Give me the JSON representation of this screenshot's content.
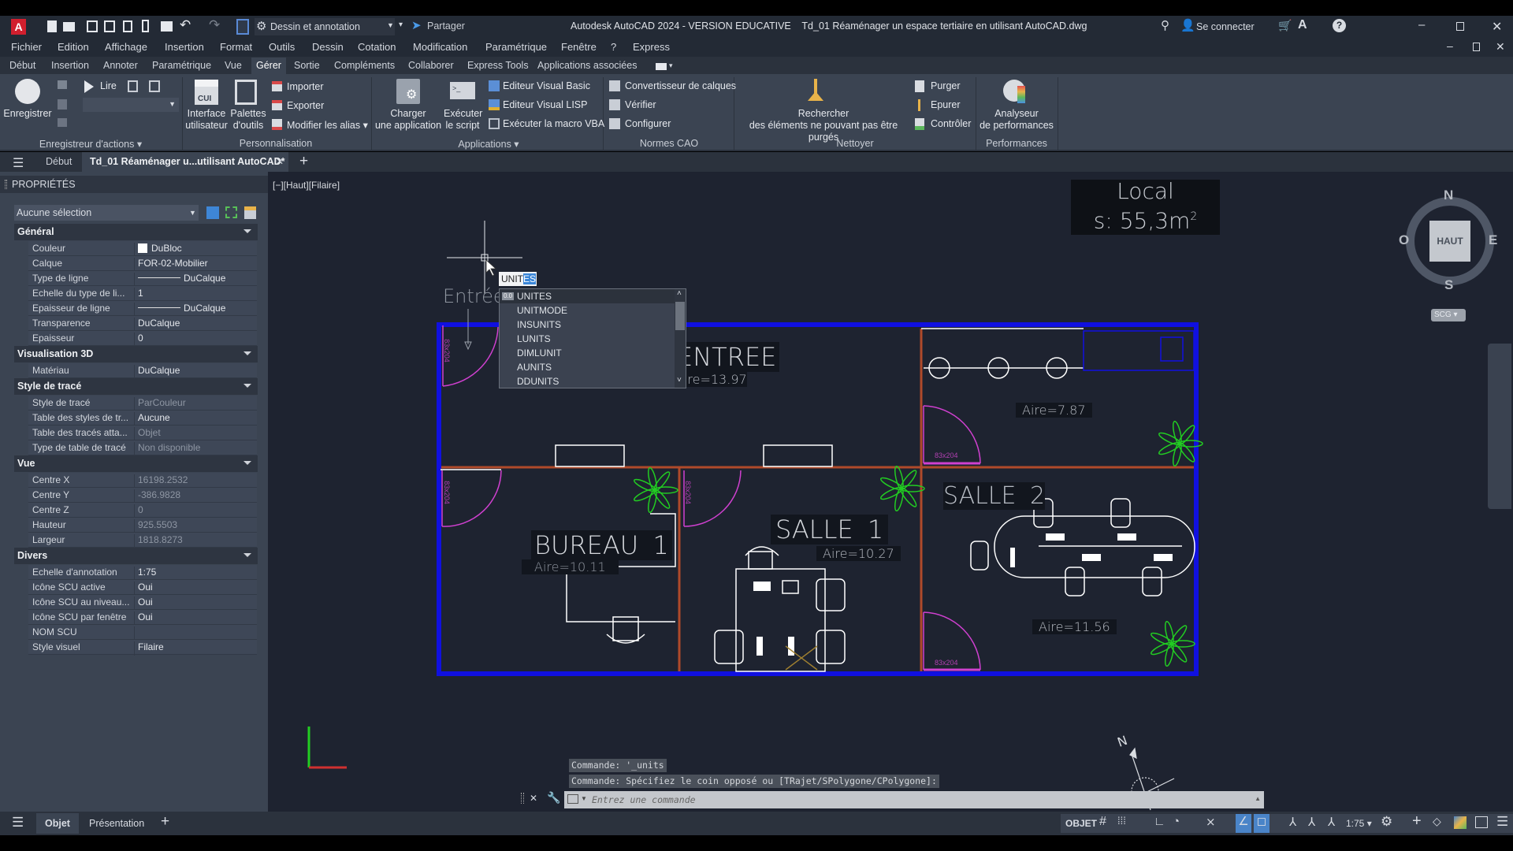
{
  "titlebar": {
    "app_letter": "A",
    "workspace": "Dessin et annotation",
    "share": "Partager",
    "title": "Autodesk AutoCAD 2024 - VERSION EDUCATIVE    Td_01 Réaménager un espace tertiaire en utilisant AutoCAD.dwg",
    "signin": "Se connecter"
  },
  "menu": [
    "Fichier",
    "Edition",
    "Affichage",
    "Insertion",
    "Format",
    "Outils",
    "Dessin",
    "Cotation",
    "Modification",
    "Paramétrique",
    "Fenêtre",
    "?",
    "Express"
  ],
  "ribbon_tabs": [
    "Début",
    "Insertion",
    "Annoter",
    "Paramétrique",
    "Vue",
    "Gérer",
    "Sortie",
    "Compléments",
    "Collaborer",
    "Express Tools",
    "Applications associées"
  ],
  "ribbon_active_tab": "Gérer",
  "ribbon": {
    "record": "Enregistrer",
    "play": "Lire",
    "cui": [
      "Interface",
      "utilisateur"
    ],
    "cui_icon_text": "CUI",
    "palettes": [
      "Palettes",
      "d'outils"
    ],
    "import": "Importer",
    "export": "Exporter",
    "alias": "Modifier les alias",
    "load_app": [
      "Charger",
      "une application"
    ],
    "run_script": [
      "Exécuter",
      "le script"
    ],
    "vba_editor": "Editeur Visual Basic",
    "lisp_editor": "Editeur Visual LISP",
    "run_vba": "Exécuter la macro VBA",
    "layer_translator": "Convertisseur de calques",
    "check": "Vérifier",
    "configure": "Configurer",
    "find_nonpurgeable": [
      "Rechercher",
      "des éléments ne pouvant pas être purgés"
    ],
    "purge": "Purger",
    "overkill": "Epurer",
    "audit": "Contrôler",
    "perf": [
      "Analyseur",
      "de performances"
    ],
    "groups": [
      "Enregistreur d'actions",
      "Personnalisation",
      "Applications",
      "Normes CAO",
      "Nettoyer",
      "Performances"
    ]
  },
  "doctabs": {
    "start": "Début",
    "active": "Td_01 Réaménager u...utilisant AutoCAD*"
  },
  "properties": {
    "title": "PROPRIÉTÉS",
    "selection": "Aucune sélection",
    "sections": [
      {
        "name": "Général",
        "rows": [
          [
            "Couleur",
            "DuBloc"
          ],
          [
            "Calque",
            "FOR-02-Mobilier"
          ],
          [
            "Type de ligne",
            "DuCalque"
          ],
          [
            "Echelle du type de li...",
            "1"
          ],
          [
            "Epaisseur de ligne",
            "DuCalque"
          ],
          [
            "Transparence",
            "DuCalque"
          ],
          [
            "Epaisseur",
            "0"
          ]
        ]
      },
      {
        "name": "Visualisation 3D",
        "rows": [
          [
            "Matériau",
            "DuCalque"
          ]
        ]
      },
      {
        "name": "Style de tracé",
        "rows": [
          [
            "Style de tracé",
            "ParCouleur"
          ],
          [
            "Table des styles de tr...",
            "Aucune"
          ],
          [
            "Table des tracés atta...",
            "Objet"
          ],
          [
            "Type de table de tracé",
            "Non disponible"
          ]
        ]
      },
      {
        "name": "Vue",
        "rows": [
          [
            "Centre X",
            "16198.2532"
          ],
          [
            "Centre Y",
            "-386.9828"
          ],
          [
            "Centre Z",
            "0"
          ],
          [
            "Hauteur",
            "925.5503"
          ],
          [
            "Largeur",
            "1818.8273"
          ]
        ]
      },
      {
        "name": "Divers",
        "rows": [
          [
            "Echelle d'annotation",
            "1:75"
          ],
          [
            "Icône SCU active",
            "Oui"
          ],
          [
            "Icône SCU au niveau...",
            "Oui"
          ],
          [
            "Icône SCU par fenêtre",
            "Oui"
          ],
          [
            "NOM SCU",
            ""
          ],
          [
            "Style visuel",
            "Filaire"
          ]
        ]
      }
    ],
    "dim_values": [
      "ParCouleur",
      "Objet",
      "Non disponible",
      "16198.2532",
      "-386.9828",
      "0",
      "925.5503",
      "1818.8273"
    ]
  },
  "viewport": {
    "label": "[−][Haut][Filaire]",
    "local_title": "Local",
    "local_area": "s: 55,3m",
    "local_sup": "2",
    "entree": "Entrée",
    "rooms": {
      "entree": "ENTREE",
      "entree_area": "Aire=13.97",
      "room_area": "Aire=7.87",
      "bureau": "BUREAU 1",
      "bureau_area": "Aire=10.11",
      "salle1": "SALLE 1",
      "salle1_area": "Aire=10.27",
      "salle2": "SALLE 2",
      "salle2_area": "Aire=11.56",
      "door": "83x204"
    },
    "viewcube": {
      "n": "N",
      "s": "S",
      "e": "E",
      "o": "O",
      "face": "HAUT",
      "ucs": "SCG"
    }
  },
  "autocomplete": {
    "typed": "UNIT",
    "completion": "ES",
    "items": [
      "UNITES",
      "UNITMODE",
      "INSUNITS",
      "LUNITS",
      "DIMLUNIT",
      "AUNITS",
      "DDUNITS"
    ],
    "badge": "0.0"
  },
  "command": {
    "history": [
      "Commande: '_units",
      "Commande: Spécifiez le coin opposé ou [TRajet/SPolygone/CPolygone]:"
    ],
    "placeholder": "Entrez une commande"
  },
  "layout_tabs": [
    "Objet",
    "Présentation"
  ],
  "status": {
    "model": "OBJET",
    "scale": "1:75"
  },
  "colors": {
    "walls": "#1010e0",
    "partitions": "#b04a2a",
    "doors": "#d040d0",
    "plants": "#22cc22",
    "furniture": "#ffffff"
  }
}
